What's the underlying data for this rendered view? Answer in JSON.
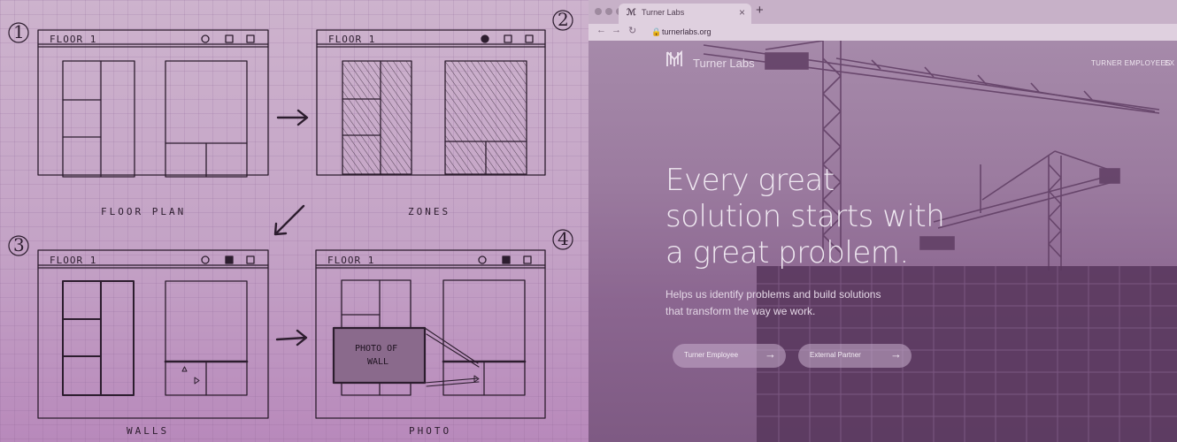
{
  "sketch": {
    "steps": [
      "1",
      "2",
      "3",
      "4"
    ],
    "frames": [
      {
        "title": "FLOOR 1",
        "caption": "FLOOR PLAN"
      },
      {
        "title": "FLOOR 1",
        "caption": "ZONES"
      },
      {
        "title": "FLOOR 1",
        "caption": "WALLS"
      },
      {
        "title": "FLOOR 1",
        "caption": "PHOTO"
      }
    ],
    "photo_note": [
      "PHOTO OF",
      "WALL"
    ]
  },
  "browser": {
    "tab_title": "Turner Labs",
    "tab_favicon": "logo-icon",
    "url": "turnerlabs.org",
    "nav_icons": [
      "back-icon",
      "forward-icon",
      "reload-icon",
      "lock-icon"
    ]
  },
  "site": {
    "brand": "Turner Labs",
    "nav": [
      "TURNER EMPLOYEES",
      "EX"
    ],
    "headline": [
      "Every great",
      "solution starts with",
      "a great problem."
    ],
    "subtext": [
      "Helps us identify problems and build solutions",
      "that transform the way we work."
    ],
    "buttons": [
      {
        "label": "Turner Employee"
      },
      {
        "label": "External Partner"
      }
    ]
  },
  "colors": {
    "overlay": "#8a5f88",
    "sketch_ink": "#2c1d2e",
    "hero_text": "#efe8f1"
  }
}
